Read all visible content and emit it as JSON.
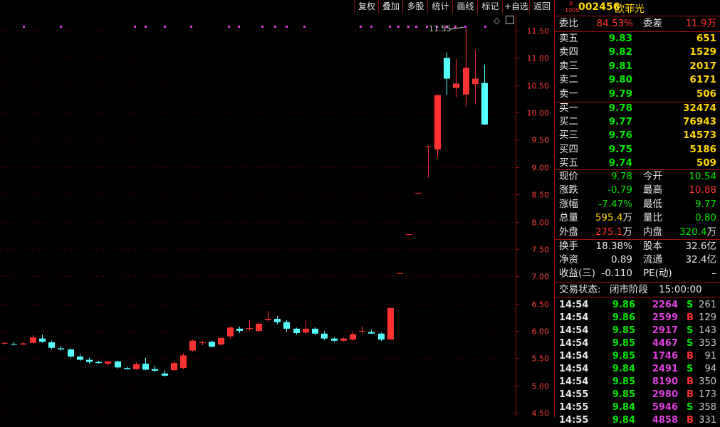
{
  "toolbar": {
    "buttons": [
      "复权",
      "叠加",
      "多股",
      "统计",
      "画线",
      "标记",
      "+自选",
      "返回"
    ]
  },
  "chart_data": {
    "type": "candlestick",
    "y_axis_ticks": [
      "11.50",
      "11.00",
      "10.50",
      "10.00",
      "9.50",
      "9.00",
      "8.50",
      "8.00",
      "7.50",
      "7.00",
      "6.50",
      "6.00",
      "5.50",
      "5.00",
      "4.50"
    ],
    "ylim": [
      4.45,
      11.68
    ],
    "max_annotation": "11.55",
    "up_color": "#ff3232",
    "down_color": "#54ffff",
    "candles": [
      {
        "o": 5.78,
        "h": 5.8,
        "l": 5.75,
        "c": 5.78
      },
      {
        "o": 5.76,
        "h": 5.79,
        "l": 5.73,
        "c": 5.75
      },
      {
        "o": 5.75,
        "h": 5.8,
        "l": 5.74,
        "c": 5.77
      },
      {
        "o": 5.78,
        "h": 5.92,
        "l": 5.77,
        "c": 5.88
      },
      {
        "o": 5.86,
        "h": 5.93,
        "l": 5.78,
        "c": 5.8
      },
      {
        "o": 5.79,
        "h": 5.82,
        "l": 5.66,
        "c": 5.69
      },
      {
        "o": 5.68,
        "h": 5.72,
        "l": 5.64,
        "c": 5.66
      },
      {
        "o": 5.66,
        "h": 5.68,
        "l": 5.5,
        "c": 5.53
      },
      {
        "o": 5.53,
        "h": 5.57,
        "l": 5.45,
        "c": 5.47
      },
      {
        "o": 5.47,
        "h": 5.51,
        "l": 5.4,
        "c": 5.43
      },
      {
        "o": 5.43,
        "h": 5.45,
        "l": 5.4,
        "c": 5.41
      },
      {
        "o": 5.4,
        "h": 5.45,
        "l": 5.37,
        "c": 5.44
      },
      {
        "o": 5.44,
        "h": 5.46,
        "l": 5.31,
        "c": 5.33
      },
      {
        "o": 5.32,
        "h": 5.35,
        "l": 5.29,
        "c": 5.3
      },
      {
        "o": 5.3,
        "h": 5.42,
        "l": 5.29,
        "c": 5.39
      },
      {
        "o": 5.4,
        "h": 5.51,
        "l": 5.28,
        "c": 5.29
      },
      {
        "o": 5.3,
        "h": 5.36,
        "l": 5.24,
        "c": 5.27
      },
      {
        "o": 5.22,
        "h": 5.28,
        "l": 5.16,
        "c": 5.18
      },
      {
        "o": 5.28,
        "h": 5.44,
        "l": 5.27,
        "c": 5.41
      },
      {
        "o": 5.32,
        "h": 5.59,
        "l": 5.3,
        "c": 5.55
      },
      {
        "o": 5.64,
        "h": 5.84,
        "l": 5.62,
        "c": 5.82
      },
      {
        "o": 5.78,
        "h": 5.82,
        "l": 5.74,
        "c": 5.79
      },
      {
        "o": 5.8,
        "h": 5.82,
        "l": 5.7,
        "c": 5.71
      },
      {
        "o": 5.75,
        "h": 5.88,
        "l": 5.73,
        "c": 5.87
      },
      {
        "o": 5.9,
        "h": 6.08,
        "l": 5.86,
        "c": 6.06
      },
      {
        "o": 6.04,
        "h": 6.08,
        "l": 5.96,
        "c": 6.0
      },
      {
        "o": 6.04,
        "h": 6.2,
        "l": 6.0,
        "c": 6.05
      },
      {
        "o": 6.0,
        "h": 6.16,
        "l": 5.98,
        "c": 6.13
      },
      {
        "o": 6.2,
        "h": 6.36,
        "l": 6.17,
        "c": 6.22
      },
      {
        "o": 6.22,
        "h": 6.27,
        "l": 6.12,
        "c": 6.16
      },
      {
        "o": 6.16,
        "h": 6.2,
        "l": 5.98,
        "c": 6.04
      },
      {
        "o": 6.04,
        "h": 6.06,
        "l": 5.93,
        "c": 5.96
      },
      {
        "o": 5.97,
        "h": 6.19,
        "l": 5.95,
        "c": 6.04
      },
      {
        "o": 6.04,
        "h": 6.07,
        "l": 5.92,
        "c": 5.95
      },
      {
        "o": 5.95,
        "h": 6.0,
        "l": 5.83,
        "c": 5.86
      },
      {
        "o": 5.86,
        "h": 5.89,
        "l": 5.8,
        "c": 5.82
      },
      {
        "o": 5.82,
        "h": 5.88,
        "l": 5.8,
        "c": 5.86
      },
      {
        "o": 5.84,
        "h": 5.98,
        "l": 5.82,
        "c": 5.94
      },
      {
        "o": 5.99,
        "h": 6.08,
        "l": 5.95,
        "c": 6.0
      },
      {
        "o": 5.98,
        "h": 6.03,
        "l": 5.94,
        "c": 5.95
      },
      {
        "o": 5.95,
        "h": 5.97,
        "l": 5.81,
        "c": 5.84
      },
      {
        "o": 5.84,
        "h": 6.42,
        "l": 5.84,
        "c": 6.42
      },
      {
        "o": 7.06,
        "h": 7.06,
        "l": 7.06,
        "c": 7.06
      },
      {
        "o": 7.77,
        "h": 7.77,
        "l": 7.77,
        "c": 7.77
      },
      {
        "o": 8.53,
        "h": 8.53,
        "l": 8.53,
        "c": 8.53
      },
      {
        "o": 9.38,
        "h": 9.38,
        "l": 8.81,
        "c": 9.38
      },
      {
        "o": 9.32,
        "h": 10.32,
        "l": 9.17,
        "c": 10.32
      },
      {
        "o": 11.0,
        "h": 11.1,
        "l": 10.32,
        "c": 10.62
      },
      {
        "o": 10.45,
        "h": 10.98,
        "l": 10.28,
        "c": 10.53
      },
      {
        "o": 10.33,
        "h": 11.55,
        "l": 10.1,
        "c": 10.82
      },
      {
        "o": 10.52,
        "h": 11.15,
        "l": 10.15,
        "c": 10.62
      },
      {
        "o": 10.54,
        "h": 10.88,
        "l": 9.77,
        "c": 9.78
      }
    ]
  },
  "quote": {
    "badge": "R\n1000",
    "code": "002456",
    "name": "欧菲光",
    "weibi_label": "委比",
    "weibi_value": "84.53%",
    "weicha_label": "委差",
    "weicha_value": "11.9万",
    "asks": [
      {
        "label": "卖五",
        "price": "9.83",
        "vol": "651"
      },
      {
        "label": "卖四",
        "price": "9.82",
        "vol": "1529"
      },
      {
        "label": "卖三",
        "price": "9.81",
        "vol": "2017"
      },
      {
        "label": "卖二",
        "price": "9.80",
        "vol": "6171"
      },
      {
        "label": "卖一",
        "price": "9.79",
        "vol": "506"
      }
    ],
    "bids": [
      {
        "label": "买一",
        "price": "9.78",
        "vol": "32474"
      },
      {
        "label": "买二",
        "price": "9.77",
        "vol": "76943"
      },
      {
        "label": "买三",
        "price": "9.76",
        "vol": "14573"
      },
      {
        "label": "买四",
        "price": "9.75",
        "vol": "5186"
      },
      {
        "label": "买五",
        "price": "9.74",
        "vol": "509"
      }
    ],
    "stats1": [
      {
        "l1": "现价",
        "v1": "9.78",
        "c1": "green",
        "l2": "今开",
        "v2": "10.54",
        "c2": "green"
      },
      {
        "l1": "涨跌",
        "v1": "-0.79",
        "c1": "green",
        "l2": "最高",
        "v2": "10.88",
        "c2": "red"
      },
      {
        "l1": "涨幅",
        "v1": "-7.47%",
        "c1": "green",
        "l2": "最低",
        "v2": "9.77",
        "c2": "green"
      },
      {
        "l1": "总量",
        "v1": "595.4",
        "u1": "万",
        "c1": "yellow",
        "l2": "量比",
        "v2": "0.80",
        "c2": "green"
      },
      {
        "l1": "外盘",
        "v1": "275.1",
        "u1": "万",
        "c1": "red",
        "l2": "内盘",
        "v2": "320.4",
        "u2": "万",
        "c2": "green"
      }
    ],
    "stats2": [
      {
        "l1": "换手",
        "v1": "18.38%",
        "l2": "股本",
        "v2": "32.6",
        "u2": "亿"
      },
      {
        "l1": "净资",
        "v1": "0.89",
        "l2": "流通",
        "v2": "32.4",
        "u2": "亿"
      },
      {
        "l1": "收益(三)",
        "v1": "-0.110",
        "l2": "PE(动)",
        "v2": "–"
      }
    ],
    "status_label": "交易状态:",
    "status_value": "闭市阶段",
    "status_time": "15:00:00",
    "ticks": [
      {
        "time": "14:54",
        "price": "9.86",
        "vol": "2264",
        "side": "S",
        "n": "261"
      },
      {
        "time": "14:54",
        "price": "9.86",
        "vol": "2599",
        "side": "B",
        "n": "129"
      },
      {
        "time": "14:54",
        "price": "9.85",
        "vol": "2917",
        "side": "S",
        "n": "143"
      },
      {
        "time": "14:54",
        "price": "9.85",
        "vol": "4467",
        "side": "S",
        "n": "353"
      },
      {
        "time": "14:54",
        "price": "9.85",
        "vol": "1746",
        "side": "B",
        "n": "91"
      },
      {
        "time": "14:54",
        "price": "9.84",
        "vol": "2491",
        "side": "S",
        "n": "94"
      },
      {
        "time": "14:54",
        "price": "9.85",
        "vol": "8190",
        "side": "B",
        "n": "350"
      },
      {
        "time": "14:55",
        "price": "9.85",
        "vol": "2980",
        "side": "B",
        "n": "173"
      },
      {
        "time": "14:55",
        "price": "9.84",
        "vol": "5946",
        "side": "S",
        "n": "358"
      },
      {
        "time": "14:55",
        "price": "9.84",
        "vol": "4858",
        "side": "B",
        "n": "331"
      }
    ]
  }
}
